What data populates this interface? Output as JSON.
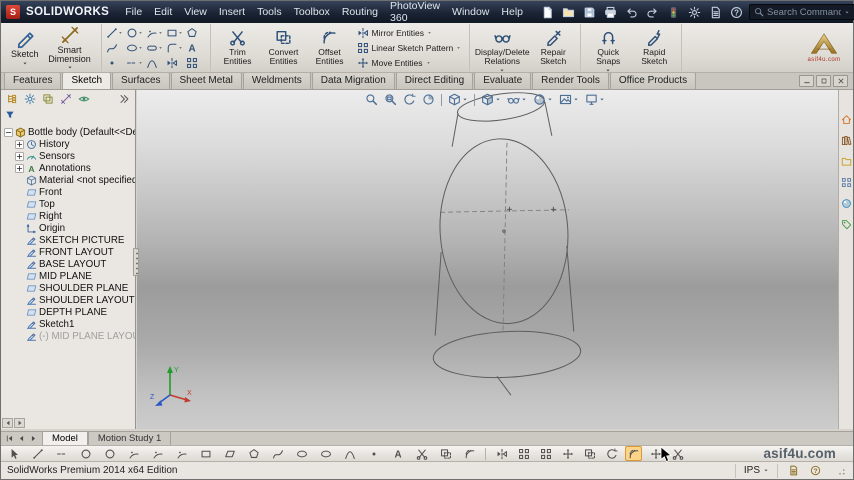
{
  "titlebar": {
    "app_name": "SOLIDWORKS",
    "menus": [
      "File",
      "Edit",
      "View",
      "Insert",
      "Tools",
      "Toolbox",
      "Routing",
      "PhotoView 360",
      "Window",
      "Help"
    ],
    "quick_icons": [
      "new-document",
      "open",
      "save",
      "print",
      "undo",
      "redo",
      "rebuild",
      "options",
      "file-properties",
      "help"
    ],
    "search": {
      "placeholder": "Search Command"
    }
  },
  "ribbon": {
    "sketch_label": "Sketch",
    "smart_dimension_label": "Smart Dimension",
    "entity_tools": [
      {
        "name": "line",
        "caret": true
      },
      {
        "name": "circle",
        "caret": true
      },
      {
        "name": "arc",
        "caret": true
      },
      {
        "name": "rect",
        "caret": true
      },
      {
        "name": "polygon",
        "caret": false
      },
      {
        "name": "spline",
        "caret": false
      },
      {
        "name": "ellipse",
        "caret": true
      },
      {
        "name": "slot",
        "caret": true
      },
      {
        "name": "fillet",
        "caret": true
      },
      {
        "name": "text",
        "caret": false
      },
      {
        "name": "point",
        "caret": false
      },
      {
        "name": "centerline",
        "caret": true
      },
      {
        "name": "conic",
        "caret": false
      },
      {
        "name": "mirror",
        "caret": false
      },
      {
        "name": "pattern",
        "caret": false
      }
    ],
    "trim_label": "Trim Entities",
    "convert_label": "Convert Entities",
    "offset_label": "Offset Entities",
    "mirror_label": "Mirror Entities",
    "linear_pattern_label": "Linear Sketch Pattern",
    "move_label": "Move Entities",
    "display_delete_label": "Display/Delete Relations",
    "repair_label": "Repair Sketch",
    "quick_snaps_label": "Quick Snaps",
    "rapid_label": "Rapid Sketch",
    "partner_logo_text": "asif4u.com"
  },
  "command_tabs": {
    "items": [
      "Features",
      "Sketch",
      "Surfaces",
      "Sheet Metal",
      "Weldments",
      "Data Migration",
      "Direct Editing",
      "Evaluate",
      "Render Tools",
      "Office Products"
    ],
    "active": "Sketch"
  },
  "feature_tree": {
    "items": [
      {
        "label": "Bottle body  (Default<<Default>",
        "icon": "part",
        "expand": "minus",
        "level": 0,
        "muted": false
      },
      {
        "label": "History",
        "icon": "history",
        "expand": "plus",
        "level": 1,
        "muted": false
      },
      {
        "label": "Sensors",
        "icon": "sensors",
        "expand": "plus",
        "level": 1,
        "muted": false
      },
      {
        "label": "Annotations",
        "icon": "annotations",
        "expand": "plus",
        "level": 1,
        "muted": false
      },
      {
        "label": "Material <not specified>",
        "icon": "material",
        "expand": "none",
        "level": 1,
        "muted": false
      },
      {
        "label": "Front",
        "icon": "plane",
        "expand": "none",
        "level": 1,
        "muted": false
      },
      {
        "label": "Top",
        "icon": "plane",
        "expand": "none",
        "level": 1,
        "muted": false
      },
      {
        "label": "Right",
        "icon": "plane",
        "expand": "none",
        "level": 1,
        "muted": false
      },
      {
        "label": "Origin",
        "icon": "origin",
        "expand": "none",
        "level": 1,
        "muted": false
      },
      {
        "label": "SKETCH PICTURE",
        "icon": "sketch",
        "expand": "none",
        "level": 1,
        "muted": false
      },
      {
        "label": "FRONT LAYOUT",
        "icon": "sketch",
        "expand": "none",
        "level": 1,
        "muted": false
      },
      {
        "label": "BASE LAYOUT",
        "icon": "sketch",
        "expand": "none",
        "level": 1,
        "muted": false
      },
      {
        "label": "MID PLANE",
        "icon": "plane",
        "expand": "none",
        "level": 1,
        "muted": false
      },
      {
        "label": "SHOULDER PLANE",
        "icon": "plane",
        "expand": "none",
        "level": 1,
        "muted": false
      },
      {
        "label": "SHOULDER LAYOUT",
        "icon": "sketch",
        "expand": "none",
        "level": 1,
        "muted": false
      },
      {
        "label": "DEPTH PLANE",
        "icon": "plane",
        "expand": "none",
        "level": 1,
        "muted": false
      },
      {
        "label": "Sketch1",
        "icon": "sketch",
        "expand": "none",
        "level": 1,
        "muted": false
      },
      {
        "label": "(-) MID PLANE LAYOUT",
        "icon": "sketch",
        "expand": "none",
        "level": 1,
        "muted": true
      }
    ]
  },
  "viewport": {
    "hud": [
      "zoom-to-fit",
      "zoom-to-area",
      "previous-view",
      "section-view",
      "sep",
      "view-orientation",
      "sep",
      "display-style",
      "hide-show-items",
      "edit-appearance",
      "apply-scene",
      "view-settings"
    ],
    "task_pane": [
      "solidworks-resources",
      "design-library",
      "file-explorer",
      "view-palette",
      "appearances-scenes",
      "custom-properties"
    ],
    "triad": {
      "x": "X",
      "y": "Y",
      "z": "Z"
    }
  },
  "model_tabs": {
    "items": [
      "Model",
      "Motion Study 1"
    ],
    "active": "Model"
  },
  "bottom_toolbar": {
    "left_icons": [
      "select",
      "line",
      "centerline",
      "circle",
      "perimeter-circle",
      "centerpoint-arc",
      "tangent-arc",
      "three-point-arc",
      "rect",
      "parallelogram",
      "polygon",
      "spline",
      "ellipse",
      "partial-ellipse",
      "parabola",
      "point",
      "text-tool",
      "trim",
      "convert",
      "offset"
    ],
    "right_icons": [
      "mirror",
      "linear-pattern",
      "circular-pattern",
      "move",
      "copy",
      "rotate",
      "scale-tool",
      "stretch",
      "split"
    ],
    "active_icon": "scale-tool"
  },
  "status_bar": {
    "message": "SolidWorks Premium 2014 x64 Edition",
    "units": "IPS",
    "icons": [
      "status-note",
      "status-tips"
    ]
  },
  "watermark": "asif4u.com"
}
